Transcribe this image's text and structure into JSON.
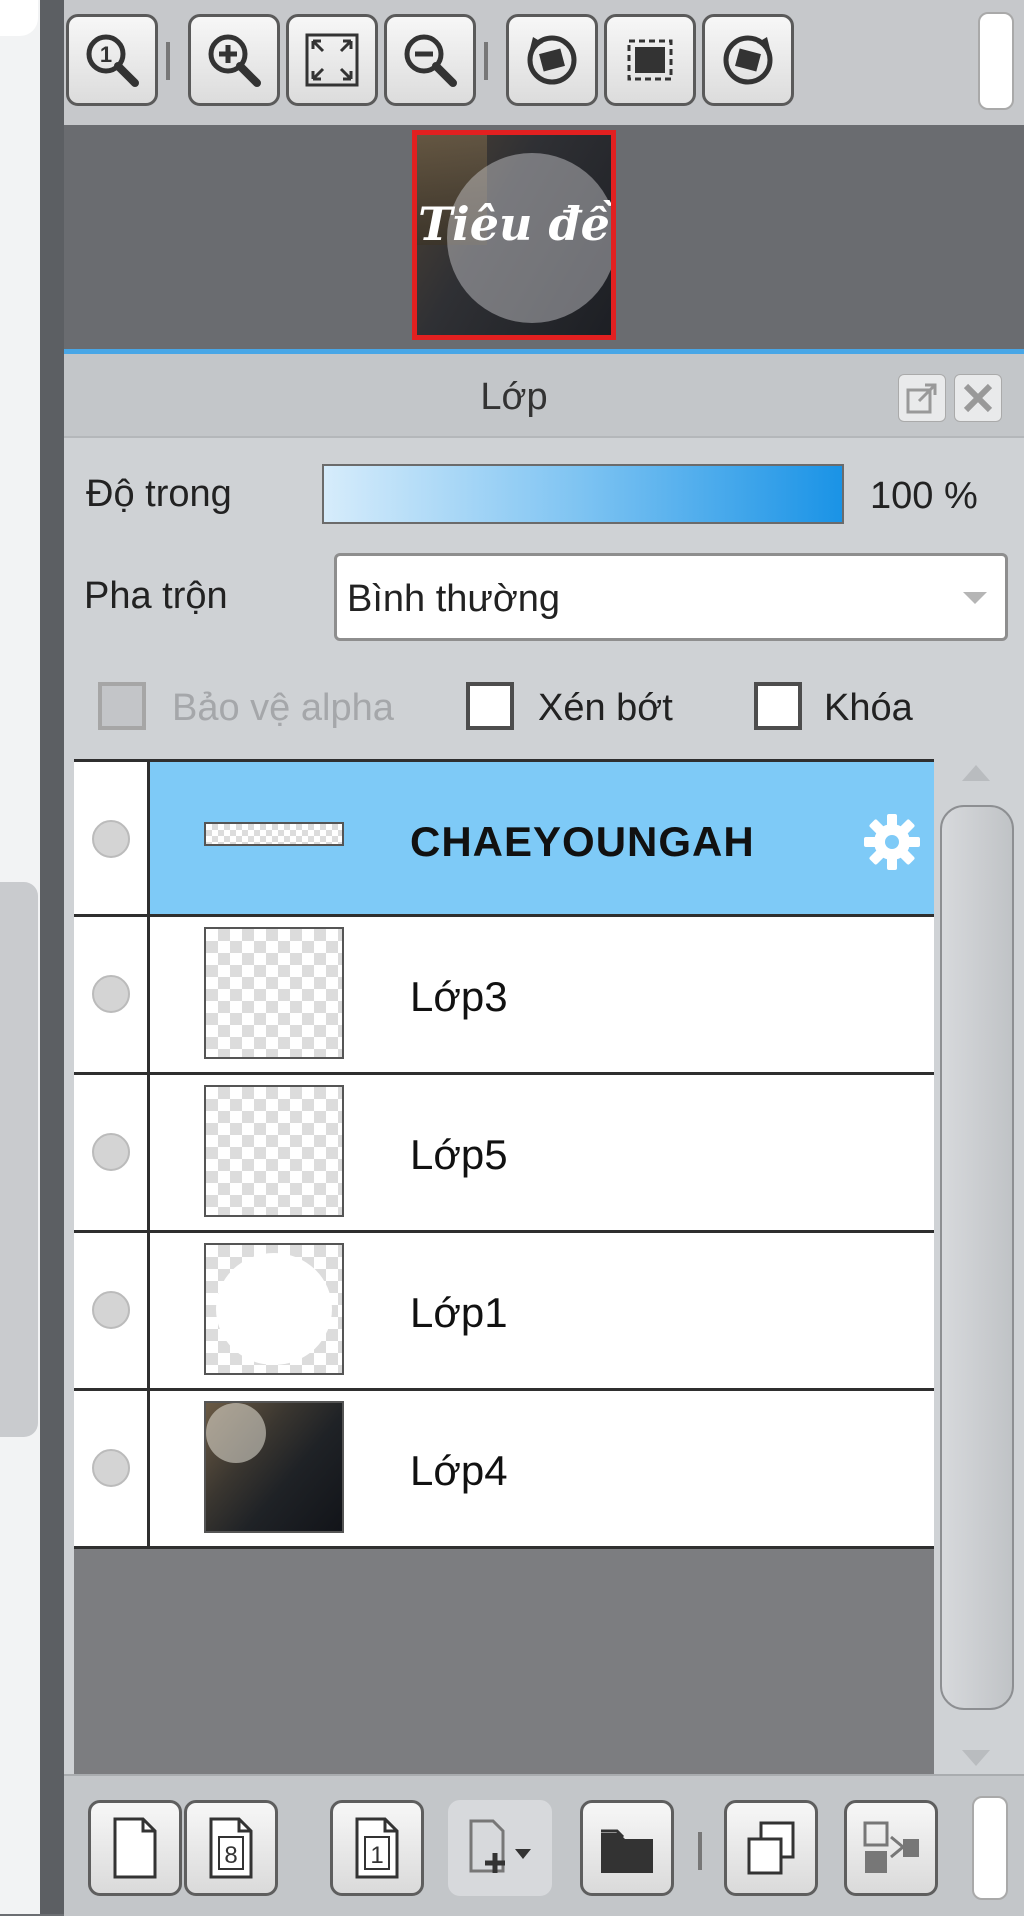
{
  "toolbar": {
    "buttons": [
      {
        "icon": "zoom-actual-size-icon"
      },
      {
        "icon": "zoom-in-icon"
      },
      {
        "icon": "fit-screen-icon"
      },
      {
        "icon": "zoom-out-icon"
      },
      {
        "icon": "rotate-left-icon"
      },
      {
        "icon": "reset-rotation-icon"
      },
      {
        "icon": "rotate-right-icon"
      }
    ]
  },
  "navigator": {
    "preview_text": "Tiêu đề"
  },
  "layers_panel": {
    "title": "Lớp",
    "opacity_label": "Độ trong",
    "opacity_value": "100 %",
    "opacity_fraction": 1.0,
    "blend_label": "Pha trộn",
    "blend_value": "Bình thường",
    "checkboxes": {
      "protect_alpha": {
        "label": "Bảo vệ alpha",
        "checked": false,
        "disabled": true
      },
      "clipping": {
        "label": "Xén bớt",
        "checked": false
      },
      "lock": {
        "label": "Khóa",
        "checked": false
      }
    },
    "layers": [
      {
        "name": "CHAEYOUNGAH",
        "selected": true,
        "thumb": "text"
      },
      {
        "name": "Lớp3",
        "selected": false,
        "thumb": "transparent"
      },
      {
        "name": "Lớp5",
        "selected": false,
        "thumb": "transparent"
      },
      {
        "name": "Lớp1",
        "selected": false,
        "thumb": "circle"
      },
      {
        "name": "Lớp4",
        "selected": false,
        "thumb": "photo"
      }
    ],
    "bottom_toolbar": {
      "buttons": [
        {
          "icon": "new-layer-icon"
        },
        {
          "icon": "new-8bit-layer-icon",
          "label": "8"
        },
        {
          "icon": "new-1bit-layer-icon",
          "label": "1"
        },
        {
          "icon": "add-layer-dropdown-icon"
        },
        {
          "icon": "new-folder-icon"
        },
        {
          "icon": "duplicate-layer-icon"
        },
        {
          "icon": "merge-down-icon"
        }
      ]
    }
  },
  "colors": {
    "selected_row": "#7ecaf7",
    "accent_line": "#48a6e6",
    "navigator_frame": "#e22020"
  }
}
